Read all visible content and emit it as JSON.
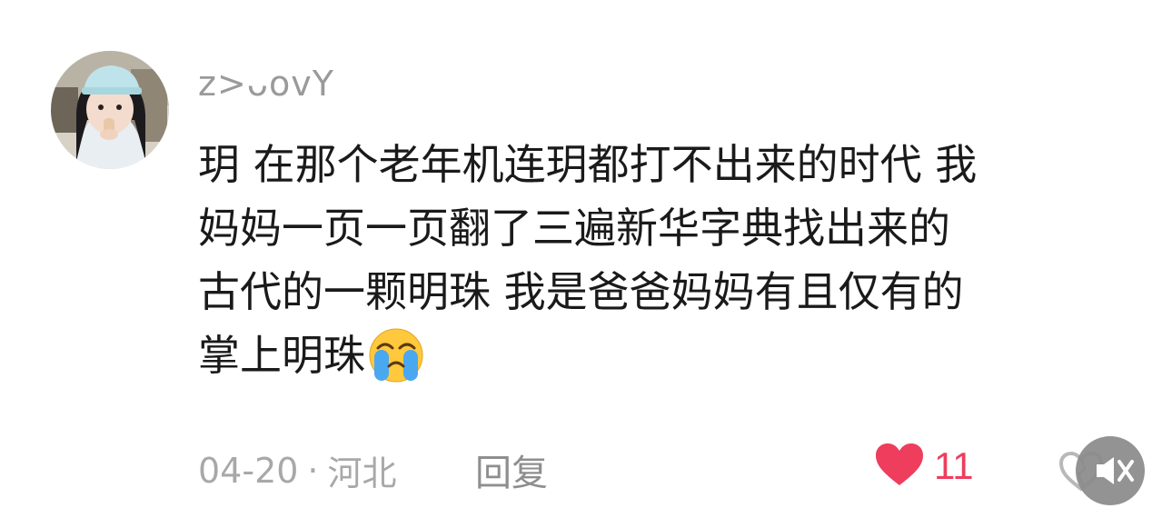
{
  "comment": {
    "username": "z>ᴗovY",
    "text_lines": [
      "玥 在那个老年机连玥都打不出来的时代 我",
      "妈妈一页一页翻了三遍新华字典找出来的",
      "古代的一颗明珠 我是爸爸妈妈有且仅有的",
      "掌上明珠"
    ],
    "emoji": "loudly-crying-face",
    "date": "04-20",
    "separator": "·",
    "location": "河北",
    "reply_label": "回复",
    "like_count": "11",
    "liked": true
  },
  "colors": {
    "like": "#ee3d5d",
    "meta_text": "#a8a8a8",
    "username": "#9a9a9a",
    "body_text": "#1a1a1a"
  }
}
